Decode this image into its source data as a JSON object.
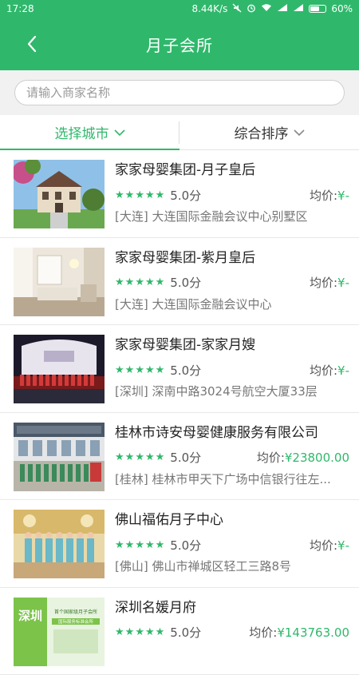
{
  "status_bar": {
    "time": "17:28",
    "network_speed": "8.44K/s",
    "battery": "60%",
    "battery_level": 0.6
  },
  "header": {
    "title": "月子会所"
  },
  "search": {
    "placeholder": "请输入商家名称",
    "value": ""
  },
  "filters": [
    {
      "label": "选择城市",
      "active": true
    },
    {
      "label": "综合排序",
      "active": false
    }
  ],
  "colors": {
    "accent": "#2fb86b",
    "star": "#2fb86b"
  },
  "list": [
    {
      "name": "家家母婴集团-月子皇后",
      "rating": "5.0分",
      "price_label": "均价:",
      "price": "¥-",
      "address": "[大连] 大连国际金融会议中心别墅区",
      "image": "villa-photo"
    },
    {
      "name": "家家母婴集团-紫月皇后",
      "rating": "5.0分",
      "price_label": "均价:",
      "price": "¥-",
      "address": "[大连] 大连国际金融会议中心",
      "image": "interior-photo"
    },
    {
      "name": "家家母婴集团-家家月嫂",
      "rating": "5.0分",
      "price_label": "均价:",
      "price": "¥-",
      "address": "[深圳] 深南中路3024号航空大厦33层",
      "image": "stage-photo"
    },
    {
      "name": "桂林市诗安母婴健康服务有限公司",
      "rating": "5.0分",
      "price_label": "均价:",
      "price": "¥23800.00",
      "address": "[桂林] 桂林市甲天下广场中信银行往左...",
      "image": "building-photo"
    },
    {
      "name": "佛山福佑月子中心",
      "rating": "5.0分",
      "price_label": "均价:",
      "price": "¥-",
      "address": "[佛山] 佛山市禅城区轻工三路8号",
      "image": "staff-photo"
    },
    {
      "name": "深圳名媛月府",
      "rating": "5.0分",
      "price_label": "均价:",
      "price": "¥143763.00",
      "address": "",
      "image": "banner-photo",
      "image_text": {
        "city": "深圳",
        "line1": "首个国家级月子会所",
        "line2": "国际服务标准会所"
      }
    }
  ]
}
